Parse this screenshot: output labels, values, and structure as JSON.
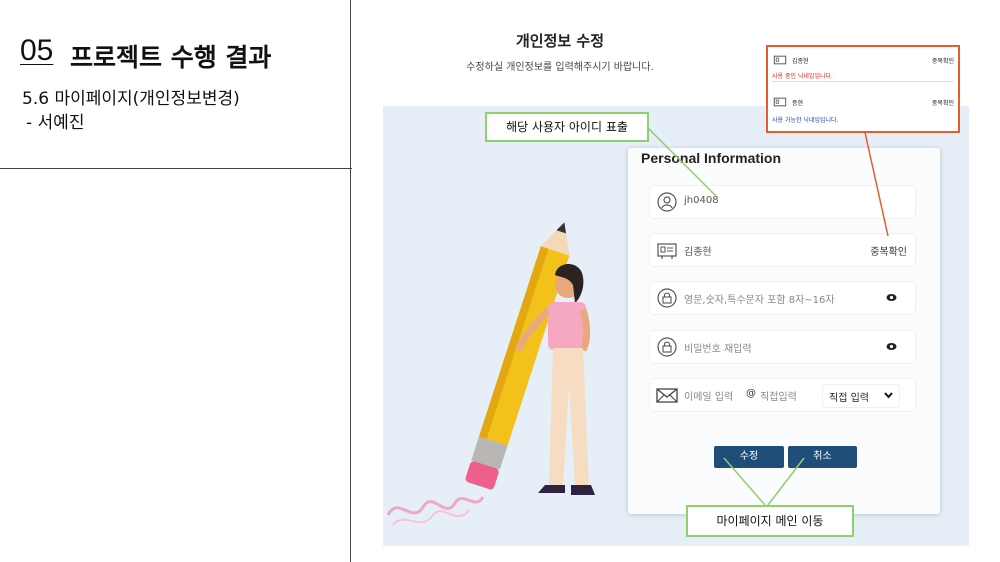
{
  "slide": {
    "section_number": "05",
    "section_title": "프로젝트 수행 결과",
    "subtitle": "5.6 마이페이지(개인정보변경)",
    "author": "- 서예진"
  },
  "page": {
    "title": "개인정보 수정",
    "subtitle": "수정하실 개인정보를 입력해주시기 바랍니다."
  },
  "form": {
    "heading": "Personal Information",
    "user_id": "jh0408",
    "nickname": "김종현",
    "dup_check_label": "중복확인",
    "password_placeholder": "영문,숫자,특수문자 포함 8자~16자",
    "password_confirm_placeholder": "비밀번호 재입력",
    "email_placeholder": "이메일 입력",
    "email_at": "@",
    "domain_placeholder": "직접입력",
    "domain_select": "직접 입력",
    "submit_label": "수정",
    "cancel_label": "취소"
  },
  "callouts": {
    "user_id_note": "해당 사용자 아이디 표출",
    "main_move_note": "마이페이지 메인 이동"
  },
  "nickname_check": {
    "row1_name": "김종현",
    "row1_button": "중복확인",
    "row1_message": "사용 중인 닉네임입니다.",
    "row2_name": "종현",
    "row2_button": "중복확인",
    "row2_message": "사용 가능한 닉네임입니다."
  },
  "colors": {
    "button": "#1f4e79",
    "callout_border": "#8fcf6d",
    "highlight_border": "#e85b2f",
    "error_text": "#e02020",
    "ok_text": "#1f3fbf",
    "canvas": "#e6eff8"
  }
}
